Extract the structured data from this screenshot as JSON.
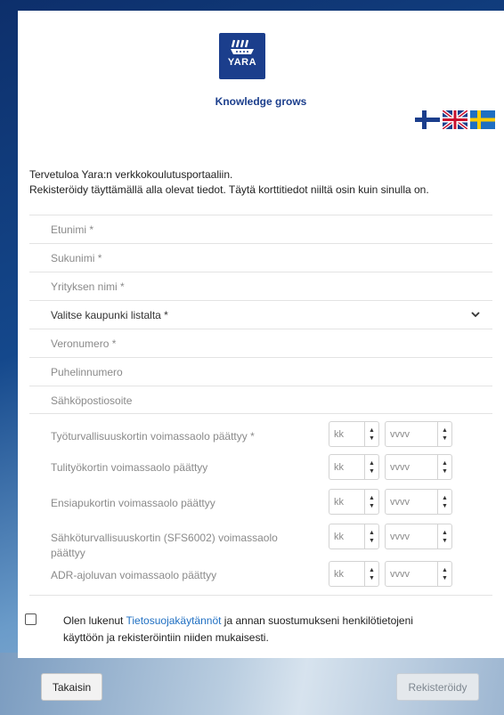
{
  "brand": {
    "logo_text": "YARA",
    "tagline": "Knowledge grows",
    "color": "#1b3e8c"
  },
  "languages": [
    {
      "name": "fi-flag-icon"
    },
    {
      "name": "uk-flag-icon"
    },
    {
      "name": "se-flag-icon"
    }
  ],
  "intro": {
    "line1": "Tervetuloa Yara:n verkkokoulutusportaaliin.",
    "line2": "Rekisteröidy täyttämällä alla olevat tiedot. Täytä korttitiedot niiltä osin kuin sinulla on."
  },
  "fields": {
    "first_name": "Etunimi *",
    "last_name": "Sukunimi *",
    "company": "Yrityksen nimi *",
    "city_select": "Valitse kaupunki listalta *",
    "tax_number": "Veronumero *",
    "phone": "Puhelinnumero",
    "email": "Sähköpostiosoite"
  },
  "cards": [
    {
      "label": "Työturvallisuuskortin voimassaolo päättyy *",
      "month": "kk",
      "year": "vvvv"
    },
    {
      "label": "Tulityökortin voimassaolo päättyy",
      "month": "kk",
      "year": "vvvv"
    },
    {
      "label": "Ensiapukortin voimassaolo päättyy",
      "month": "kk",
      "year": "vvvv"
    },
    {
      "label": "Sähköturvallisuuskortin (SFS6002) voimassaolo päättyy",
      "month": "kk",
      "year": "vvvv"
    },
    {
      "label": "ADR-ajoluvan voimassaolo päättyy",
      "month": "kk",
      "year": "vvvv"
    }
  ],
  "consent": {
    "before": "Olen lukenut ",
    "link": "Tietosuojakäytännöt",
    "after": " ja annan suostumukseni henkilötietojeni käyttöön ja rekisteröintiin niiden mukaisesti."
  },
  "buttons": {
    "back": "Takaisin",
    "register": "Rekisteröidy"
  }
}
